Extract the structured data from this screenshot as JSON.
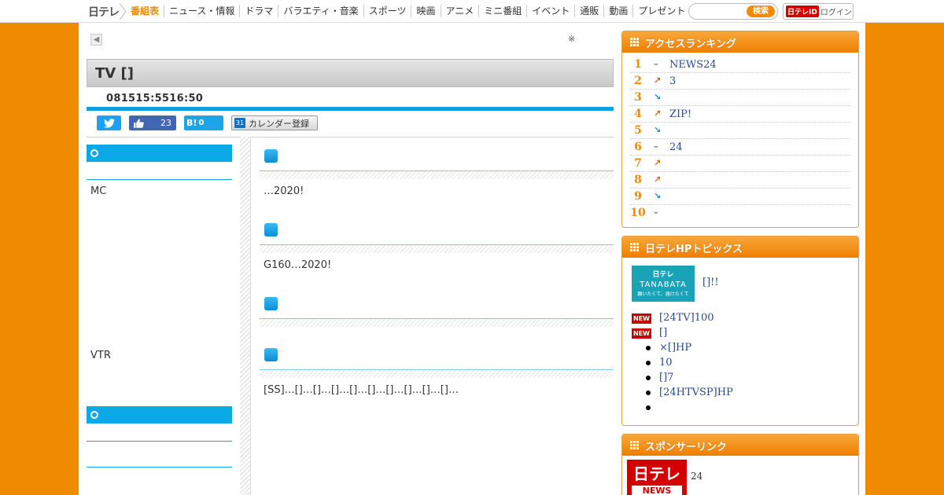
{
  "header": {
    "logo_text": "日テレ",
    "nav": [
      "番組表",
      "ニュース・情報",
      "ドラマ",
      "バラエティ・音楽",
      "スポーツ",
      "映画",
      "アニメ",
      "ミニ番組",
      "イベント",
      "通販",
      "動画",
      "プレゼント"
    ],
    "active_nav": "番組表",
    "search": {
      "placeholder": "",
      "button_label": "検索"
    },
    "login": {
      "id_label": "日テレID",
      "label": "ログイン"
    }
  },
  "program": {
    "back_icon": "back-arrow-icon",
    "note": "※",
    "title": "TV []",
    "airtime": "081515:5516:50"
  },
  "social": {
    "twitter_icon": "twitter-bird-icon",
    "fb_icon": "like-thumb-icon",
    "fb_count": "23",
    "hatena_label": "B!",
    "hatena_count": "0",
    "calendar_icon_text": "31",
    "calendar_label": "カレンダー登録"
  },
  "side_info": {
    "mc_label": "MC",
    "vtr_label": "VTR"
  },
  "content": {
    "sections": [
      {
        "text": "…2020!"
      },
      {
        "text": "G160…2020!"
      },
      {
        "text": ""
      },
      {
        "text": "[SS]…[]…[]…[]…[]…[]…[]…[]…[]…[]…"
      }
    ]
  },
  "ranking": {
    "title": "アクセスランキング",
    "items": [
      {
        "rank": "1",
        "trend": "same",
        "title": "NEWS24"
      },
      {
        "rank": "2",
        "trend": "up",
        "title": "3"
      },
      {
        "rank": "3",
        "trend": "down",
        "title": ""
      },
      {
        "rank": "4",
        "trend": "up",
        "title": "ZIP!"
      },
      {
        "rank": "5",
        "trend": "down",
        "title": ""
      },
      {
        "rank": "6",
        "trend": "same",
        "title": "24"
      },
      {
        "rank": "7",
        "trend": "up",
        "title": ""
      },
      {
        "rank": "8",
        "trend": "up",
        "title": ""
      },
      {
        "rank": "9",
        "trend": "down",
        "title": ""
      },
      {
        "rank": "10",
        "trend": "same",
        "title": ""
      }
    ]
  },
  "topics": {
    "title": "日テレHPトピックス",
    "feature": {
      "image_top": "日テレ",
      "image_main": "TANABATA",
      "image_sub": "願いたくて、届けたくて",
      "link": "[]!!"
    },
    "new_badge": "NEW",
    "new_items": [
      "[24TV]100",
      "[]"
    ],
    "bullets": [
      "×[]HP",
      "10",
      "[]7",
      "[24HTVSP]HP",
      ""
    ]
  },
  "sponsor": {
    "title": "スポンサーリンク",
    "logo_line1": "日テレ",
    "logo_line2": "NEWS",
    "text": "24"
  }
}
